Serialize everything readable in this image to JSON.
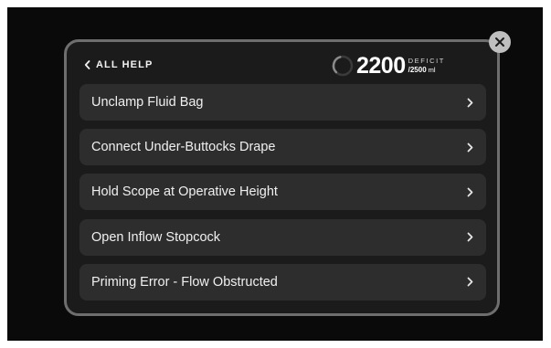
{
  "header": {
    "back_label": "ALL HELP",
    "back_icon": "chevron-left-icon",
    "close_icon": "close-icon"
  },
  "deficit": {
    "value": "2200",
    "label": "DEFICIT",
    "limit": "/2500",
    "unit": "ml",
    "progress_fraction": 0.88
  },
  "help_items": [
    {
      "label": "Unclamp Fluid Bag"
    },
    {
      "label": "Connect Under-Buttocks Drape"
    },
    {
      "label": "Hold Scope at Operative Height"
    },
    {
      "label": "Open Inflow Stopcock"
    },
    {
      "label": "Priming Error - Flow Obstructed"
    }
  ],
  "colors": {
    "background": "#0a0a0a",
    "panel": "#1b1b1b",
    "panel_border": "#6e6e6e",
    "item": "#2d2d2d",
    "text": "#f0f0f0",
    "close_button": "#bfbfbf"
  }
}
